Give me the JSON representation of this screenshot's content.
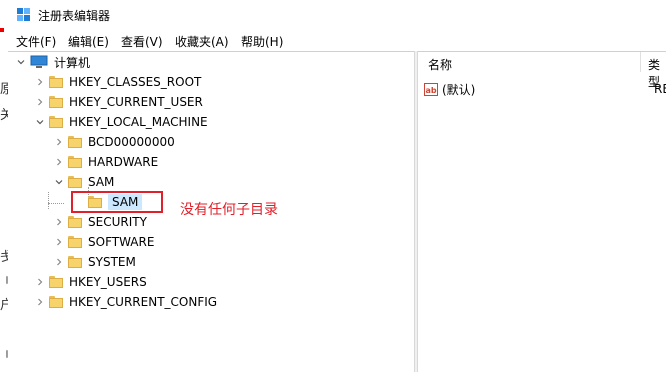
{
  "window": {
    "title": "注册表编辑器",
    "icon": "registry-editor-icon"
  },
  "menu": [
    {
      "label": "文件(F)"
    },
    {
      "label": "编辑(E)"
    },
    {
      "label": "查看(V)"
    },
    {
      "label": "收藏夹(A)"
    },
    {
      "label": "帮助(H)"
    }
  ],
  "left_strip_glyphs": [
    "原",
    "关",
    "戋",
    "刂",
    "户",
    "刂"
  ],
  "tree": {
    "root": {
      "label": "计算机",
      "icon": "computer-icon",
      "expanded": true
    },
    "nodes": [
      {
        "label": "HKEY_CLASSES_ROOT",
        "level": 1,
        "expanded": false
      },
      {
        "label": "HKEY_CURRENT_USER",
        "level": 1,
        "expanded": false
      },
      {
        "label": "HKEY_LOCAL_MACHINE",
        "level": 1,
        "expanded": true
      },
      {
        "label": "BCD00000000",
        "level": 2,
        "expanded": false
      },
      {
        "label": "HARDWARE",
        "level": 2,
        "expanded": false
      },
      {
        "label": "SAM",
        "level": 2,
        "expanded": true
      },
      {
        "label": "SAM",
        "level": 3,
        "expanded": false,
        "selected": true,
        "has_children": false
      },
      {
        "label": "SECURITY",
        "level": 2,
        "expanded": false
      },
      {
        "label": "SOFTWARE",
        "level": 2,
        "expanded": false
      },
      {
        "label": "SYSTEM",
        "level": 2,
        "expanded": false
      },
      {
        "label": "HKEY_USERS",
        "level": 1,
        "expanded": false
      },
      {
        "label": "HKEY_CURRENT_CONFIG",
        "level": 1,
        "expanded": false
      }
    ]
  },
  "list": {
    "columns": [
      "名称",
      "类型"
    ],
    "rows": [
      {
        "name": "(默认)",
        "type": "REG",
        "icon": "string-value-icon"
      }
    ]
  },
  "annotation": {
    "text": "没有任何子目录",
    "color": "#e0202a"
  },
  "colors": {
    "selection": "#cce8ff",
    "folder": "#f7d36c",
    "highlight": "#e0202a"
  }
}
